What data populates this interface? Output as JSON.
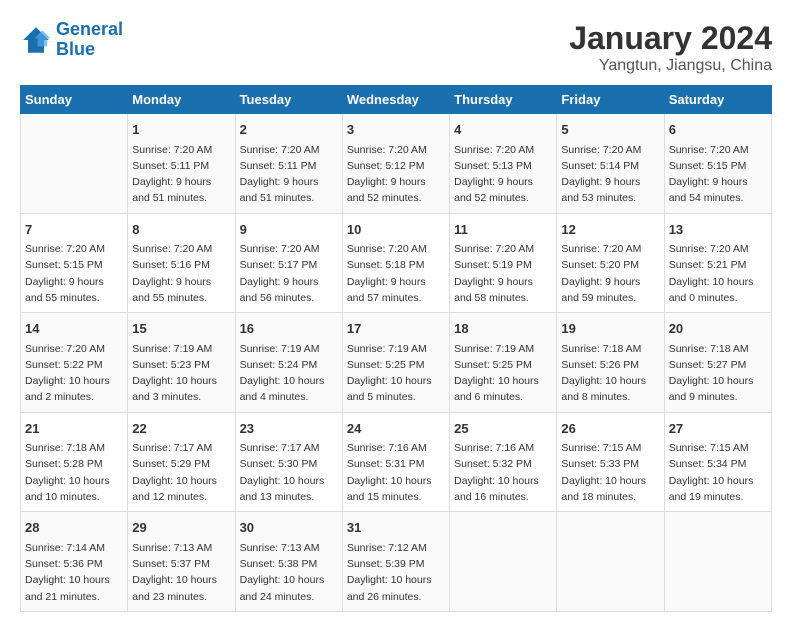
{
  "logo": {
    "line1": "General",
    "line2": "Blue"
  },
  "title": "January 2024",
  "subtitle": "Yangtun, Jiangsu, China",
  "weekdays": [
    "Sunday",
    "Monday",
    "Tuesday",
    "Wednesday",
    "Thursday",
    "Friday",
    "Saturday"
  ],
  "weeks": [
    [
      {
        "day": "",
        "info": ""
      },
      {
        "day": "1",
        "info": "Sunrise: 7:20 AM\nSunset: 5:11 PM\nDaylight: 9 hours\nand 51 minutes."
      },
      {
        "day": "2",
        "info": "Sunrise: 7:20 AM\nSunset: 5:11 PM\nDaylight: 9 hours\nand 51 minutes."
      },
      {
        "day": "3",
        "info": "Sunrise: 7:20 AM\nSunset: 5:12 PM\nDaylight: 9 hours\nand 52 minutes."
      },
      {
        "day": "4",
        "info": "Sunrise: 7:20 AM\nSunset: 5:13 PM\nDaylight: 9 hours\nand 52 minutes."
      },
      {
        "day": "5",
        "info": "Sunrise: 7:20 AM\nSunset: 5:14 PM\nDaylight: 9 hours\nand 53 minutes."
      },
      {
        "day": "6",
        "info": "Sunrise: 7:20 AM\nSunset: 5:15 PM\nDaylight: 9 hours\nand 54 minutes."
      }
    ],
    [
      {
        "day": "7",
        "info": "Sunrise: 7:20 AM\nSunset: 5:15 PM\nDaylight: 9 hours\nand 55 minutes."
      },
      {
        "day": "8",
        "info": "Sunrise: 7:20 AM\nSunset: 5:16 PM\nDaylight: 9 hours\nand 55 minutes."
      },
      {
        "day": "9",
        "info": "Sunrise: 7:20 AM\nSunset: 5:17 PM\nDaylight: 9 hours\nand 56 minutes."
      },
      {
        "day": "10",
        "info": "Sunrise: 7:20 AM\nSunset: 5:18 PM\nDaylight: 9 hours\nand 57 minutes."
      },
      {
        "day": "11",
        "info": "Sunrise: 7:20 AM\nSunset: 5:19 PM\nDaylight: 9 hours\nand 58 minutes."
      },
      {
        "day": "12",
        "info": "Sunrise: 7:20 AM\nSunset: 5:20 PM\nDaylight: 9 hours\nand 59 minutes."
      },
      {
        "day": "13",
        "info": "Sunrise: 7:20 AM\nSunset: 5:21 PM\nDaylight: 10 hours\nand 0 minutes."
      }
    ],
    [
      {
        "day": "14",
        "info": "Sunrise: 7:20 AM\nSunset: 5:22 PM\nDaylight: 10 hours\nand 2 minutes."
      },
      {
        "day": "15",
        "info": "Sunrise: 7:19 AM\nSunset: 5:23 PM\nDaylight: 10 hours\nand 3 minutes."
      },
      {
        "day": "16",
        "info": "Sunrise: 7:19 AM\nSunset: 5:24 PM\nDaylight: 10 hours\nand 4 minutes."
      },
      {
        "day": "17",
        "info": "Sunrise: 7:19 AM\nSunset: 5:25 PM\nDaylight: 10 hours\nand 5 minutes."
      },
      {
        "day": "18",
        "info": "Sunrise: 7:19 AM\nSunset: 5:25 PM\nDaylight: 10 hours\nand 6 minutes."
      },
      {
        "day": "19",
        "info": "Sunrise: 7:18 AM\nSunset: 5:26 PM\nDaylight: 10 hours\nand 8 minutes."
      },
      {
        "day": "20",
        "info": "Sunrise: 7:18 AM\nSunset: 5:27 PM\nDaylight: 10 hours\nand 9 minutes."
      }
    ],
    [
      {
        "day": "21",
        "info": "Sunrise: 7:18 AM\nSunset: 5:28 PM\nDaylight: 10 hours\nand 10 minutes."
      },
      {
        "day": "22",
        "info": "Sunrise: 7:17 AM\nSunset: 5:29 PM\nDaylight: 10 hours\nand 12 minutes."
      },
      {
        "day": "23",
        "info": "Sunrise: 7:17 AM\nSunset: 5:30 PM\nDaylight: 10 hours\nand 13 minutes."
      },
      {
        "day": "24",
        "info": "Sunrise: 7:16 AM\nSunset: 5:31 PM\nDaylight: 10 hours\nand 15 minutes."
      },
      {
        "day": "25",
        "info": "Sunrise: 7:16 AM\nSunset: 5:32 PM\nDaylight: 10 hours\nand 16 minutes."
      },
      {
        "day": "26",
        "info": "Sunrise: 7:15 AM\nSunset: 5:33 PM\nDaylight: 10 hours\nand 18 minutes."
      },
      {
        "day": "27",
        "info": "Sunrise: 7:15 AM\nSunset: 5:34 PM\nDaylight: 10 hours\nand 19 minutes."
      }
    ],
    [
      {
        "day": "28",
        "info": "Sunrise: 7:14 AM\nSunset: 5:36 PM\nDaylight: 10 hours\nand 21 minutes."
      },
      {
        "day": "29",
        "info": "Sunrise: 7:13 AM\nSunset: 5:37 PM\nDaylight: 10 hours\nand 23 minutes."
      },
      {
        "day": "30",
        "info": "Sunrise: 7:13 AM\nSunset: 5:38 PM\nDaylight: 10 hours\nand 24 minutes."
      },
      {
        "day": "31",
        "info": "Sunrise: 7:12 AM\nSunset: 5:39 PM\nDaylight: 10 hours\nand 26 minutes."
      },
      {
        "day": "",
        "info": ""
      },
      {
        "day": "",
        "info": ""
      },
      {
        "day": "",
        "info": ""
      }
    ]
  ]
}
